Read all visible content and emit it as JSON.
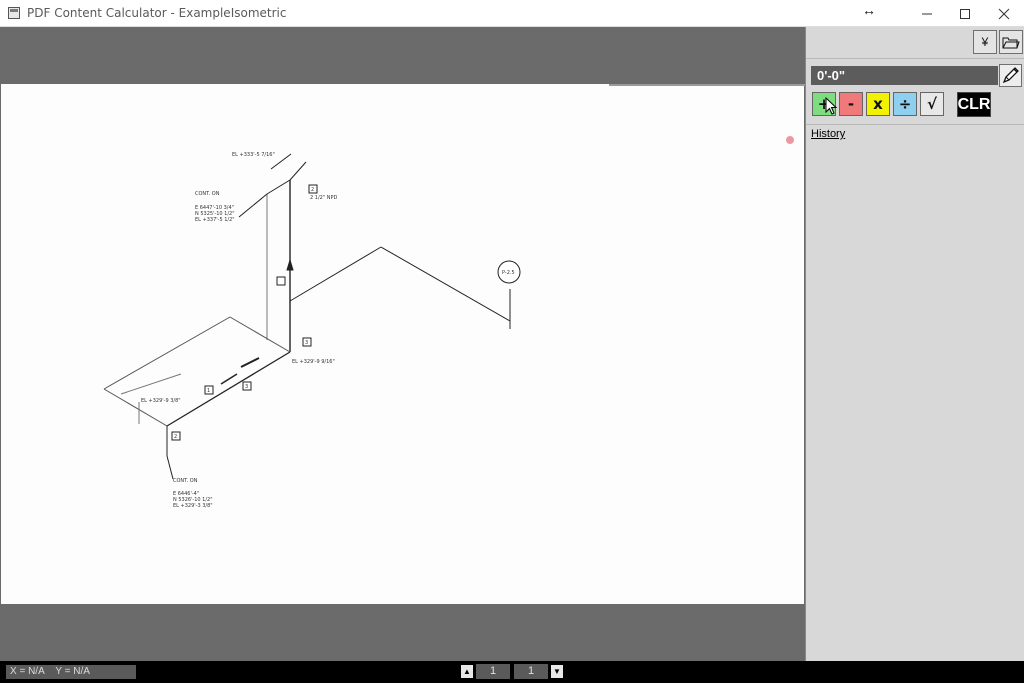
{
  "window": {
    "title": "PDF Content Calculator - ExampleIsometric",
    "resize_glyph": "↔",
    "minimize_glyph": "—",
    "maximize_glyph": "☐",
    "close_glyph": "✕"
  },
  "toolbar": {
    "currency_label": "¥",
    "open_folder_icon": "folder-open-icon"
  },
  "calculator": {
    "display_value": "0'-0\"",
    "add_label": "+",
    "subtract_label": "-",
    "multiply_label": "x",
    "divide_label": "÷",
    "sqrt_label": "√",
    "clear_label": "CLR",
    "history_label": "History",
    "colors": {
      "add": "#7fdc7f",
      "subtract": "#f07a7a",
      "multiply": "#f2f200",
      "divide": "#8fd0ee",
      "sqrt": "#e8e8e8"
    }
  },
  "status": {
    "x_label": "X = N/A",
    "y_label": "Y = N/A",
    "page_current": "1",
    "page_total": "1",
    "prev_glyph": "▲",
    "next_glyph": "▼"
  },
  "drawing": {
    "elev_top": "EL +333'-5 7/16\"",
    "cont_on_top": "CONT. ON",
    "coords_top_1": "E 6447'-10 3/4\"",
    "coords_top_2": "N 5325'-10 1/2\"",
    "coords_top_3": "EL +337'-5 1/2\"",
    "size_label": "2 1/2\" NPD",
    "tag_2_top": "2",
    "tag_3": "3",
    "tag_3b": "3",
    "tag_1": "1",
    "tag_2_bottom": "2",
    "elev_mid": "EL +329'-9 9/16\"",
    "elev_bottom": "EL +329'-9 3/8\"",
    "cont_on_bottom": "CONT. ON",
    "coords_bot_1": "E 6446'-4\"",
    "coords_bot_2": "N 5326'-10 1/2\"",
    "coords_bot_3": "EL +329'-3 3/8\"",
    "pipe_ref": "P-2.5"
  },
  "marker_color": "#e89aa0"
}
